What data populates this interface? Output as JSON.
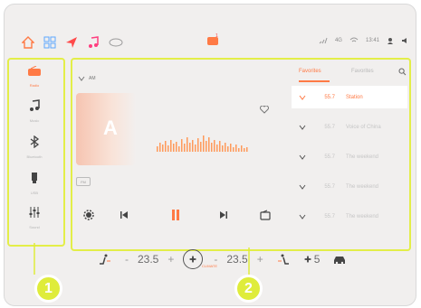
{
  "statusbar": {
    "wifi_label": "4G",
    "time": "13:41",
    "battery_label": "4G",
    "alert_badge": "1"
  },
  "sidebar": {
    "items": [
      {
        "label": "Radio"
      },
      {
        "label": "Music"
      },
      {
        "label": "Bluetooth"
      },
      {
        "label": "USB"
      },
      {
        "label": "Sound"
      }
    ]
  },
  "player": {
    "station_name": "AM",
    "album_letter": "A",
    "fm_tag": "FM"
  },
  "tabs": [
    {
      "label": "Favorites"
    },
    {
      "label": "Favorites"
    }
  ],
  "stations": [
    {
      "freq": "55.7",
      "name": "Station"
    },
    {
      "freq": "55.7",
      "name": "Voice of China"
    },
    {
      "freq": "55.7",
      "name": "The weekend"
    },
    {
      "freq": "55.7",
      "name": "The weekend"
    },
    {
      "freq": "55.7",
      "name": "The weekend"
    }
  ],
  "bottom": {
    "left_temp": "23.5",
    "right_temp": "23.5",
    "fan_speed": "5",
    "climate_label": "CLIMATE"
  },
  "callouts": [
    "1",
    "2"
  ],
  "colors": {
    "accent": "#ff7a45",
    "highlight": "#e3ee48",
    "badge": "#dfec3b"
  }
}
